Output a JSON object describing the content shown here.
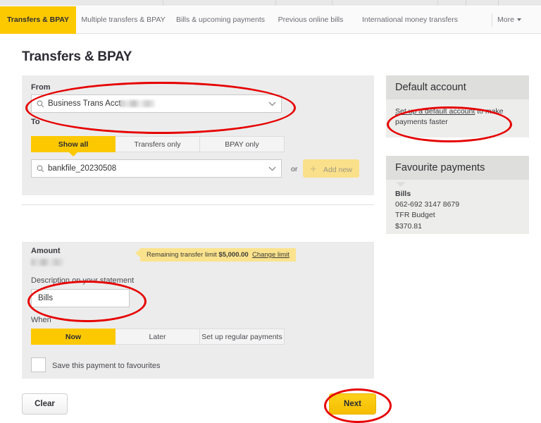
{
  "window": {
    "page_title": "Transfers & BPAY"
  },
  "tabs": [
    {
      "label": "Transfers & BPAY",
      "active": true
    },
    {
      "label": "Multiple transfers & BPAY",
      "active": false
    },
    {
      "label": "Bills & upcoming payments",
      "active": false
    },
    {
      "label": "Previous online bills",
      "active": false
    },
    {
      "label": "International money transfers",
      "active": false
    }
  ],
  "tab_more": {
    "label": "More",
    "caret": "chevron-down-icon"
  },
  "form": {
    "from": {
      "label": "From",
      "value": "Business Trans Acct",
      "masked_value": "",
      "search_icon": "search-icon",
      "chevron_icon": "chevron-down-icon"
    },
    "to": {
      "label": "To",
      "filters": [
        {
          "label": "Show all",
          "active": true
        },
        {
          "label": "Transfers only",
          "active": false
        },
        {
          "label": "BPAY only",
          "active": false
        }
      ],
      "value": "bankfile_20230508",
      "search_icon": "search-icon",
      "chevron_icon": "chevron-down-icon",
      "or_text": "or",
      "add_new_label": "Add new",
      "add_new_icon": "plus-icon"
    },
    "amount": {
      "label": "Amount",
      "value": ""
    },
    "transfer_limit_callout": {
      "prefix": "Remaining transfer limit ",
      "amount": "$5,000.00",
      "link_label": "Change limit"
    },
    "description": {
      "label": "Description on your statement",
      "value": "Bills"
    },
    "when": {
      "label": "When",
      "options": [
        {
          "label": "Now",
          "active": true
        },
        {
          "label": "Later",
          "active": false
        },
        {
          "label": "Set up regular payments",
          "active": false
        }
      ]
    },
    "save_favourite": {
      "label": "Save this payment to favourites",
      "checked": false
    }
  },
  "actions": {
    "clear_label": "Clear",
    "next_label": "Next"
  },
  "sidebar": {
    "default_account": {
      "title": "Default account",
      "link_label": "Set up a default account",
      "body_text": " to make payments faster"
    },
    "favourite_payments": {
      "title": "Favourite payments",
      "item": {
        "name": "Bills",
        "bsb_account": "062-692 3147 8679",
        "reference": "TFR Budget",
        "amount": "$370.81"
      }
    }
  },
  "colors": {
    "accent_yellow": "#fcc800",
    "annotation_red": "#e60000",
    "panel_grey": "#ececec"
  }
}
